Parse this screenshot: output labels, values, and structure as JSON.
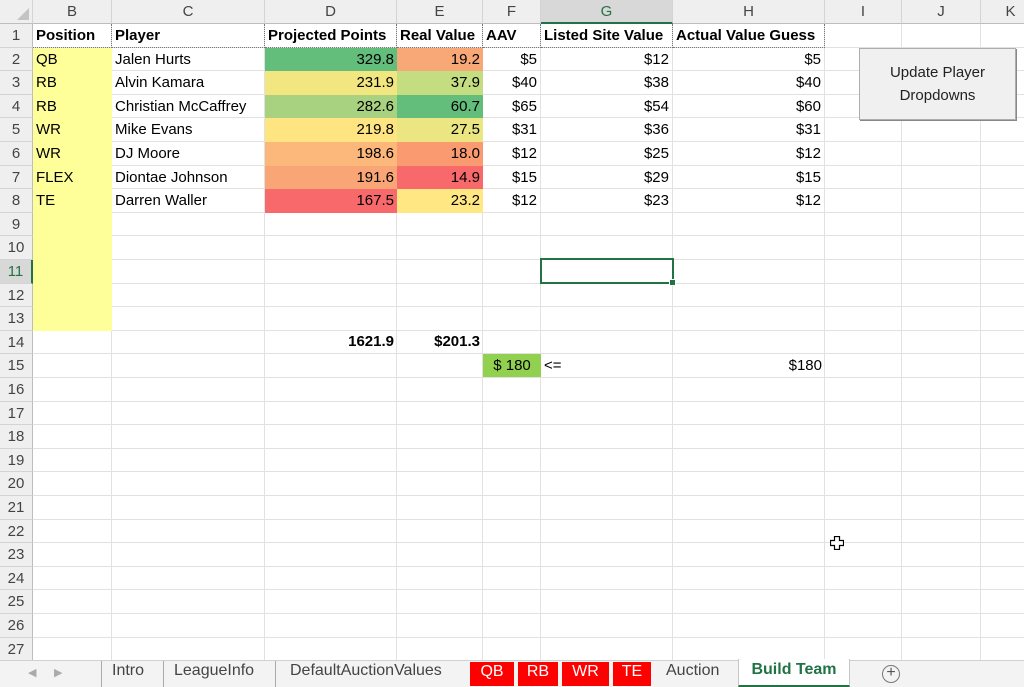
{
  "columns": [
    "B",
    "C",
    "D",
    "E",
    "F",
    "G",
    "H",
    "I",
    "J",
    "K"
  ],
  "selected_column": "G",
  "row_numbers": [
    "1",
    "2",
    "3",
    "4",
    "5",
    "6",
    "7",
    "8",
    "9",
    "10",
    "11",
    "12",
    "13",
    "14",
    "15",
    "16",
    "17",
    "18",
    "19",
    "20",
    "21",
    "22",
    "23",
    "24",
    "25",
    "26",
    "27"
  ],
  "selected_row": "11",
  "headers": {
    "position": "Position",
    "player": "Player",
    "projected_points": "Projected Points",
    "real_value": "Real Value",
    "aav": "AAV",
    "listed_site_value": "Listed Site Value",
    "actual_value_guess": "Actual Value Guess"
  },
  "rows": [
    {
      "position": "QB",
      "player": "Jalen Hurts",
      "projected_points": "329.8",
      "real_value": "19.2",
      "aav": "$5",
      "listed_site_value": "$12",
      "actual_value_guess": "$5",
      "pp_color": "#63be7b",
      "rv_color": "#f8a777"
    },
    {
      "position": "RB",
      "player": "Alvin Kamara",
      "projected_points": "231.9",
      "real_value": "37.9",
      "aav": "$40",
      "listed_site_value": "$38",
      "actual_value_guess": "$40",
      "pp_color": "#f1e67f",
      "rv_color": "#c4dd80"
    },
    {
      "position": "RB",
      "player": "Christian McCaffrey",
      "projected_points": "282.6",
      "real_value": "60.7",
      "aav": "$65",
      "listed_site_value": "$54",
      "actual_value_guess": "$60",
      "pp_color": "#a8d27f",
      "rv_color": "#63be7b"
    },
    {
      "position": "WR",
      "player": "Mike Evans",
      "projected_points": "219.8",
      "real_value": "27.5",
      "aav": "$31",
      "listed_site_value": "$36",
      "actual_value_guess": "$31",
      "pp_color": "#fee582",
      "rv_color": "#ebe582"
    },
    {
      "position": "WR",
      "player": "DJ Moore",
      "projected_points": "198.6",
      "real_value": "18.0",
      "aav": "$12",
      "listed_site_value": "$25",
      "actual_value_guess": "$12",
      "pp_color": "#fcb77a",
      "rv_color": "#f99a71"
    },
    {
      "position": "FLEX",
      "player": "Diontae Johnson",
      "projected_points": "191.6",
      "real_value": "14.9",
      "aav": "$15",
      "listed_site_value": "$29",
      "actual_value_guess": "$15",
      "pp_color": "#faa575",
      "rv_color": "#f8696b"
    },
    {
      "position": "TE",
      "player": "Darren Waller",
      "projected_points": "167.5",
      "real_value": "23.2",
      "aav": "$12",
      "listed_site_value": "$23",
      "actual_value_guess": "$12",
      "pp_color": "#f8696b",
      "rv_color": "#ffe783"
    }
  ],
  "totals": {
    "projected_points": "1621.9",
    "real_value": "$201.3"
  },
  "budget": {
    "aav_total": "$ 180",
    "comparator": "<=",
    "budget_value": "$180",
    "aav_total_color": "#92d050"
  },
  "position_fill_color": "#ffff99",
  "macro_button": {
    "line1": "Update Player",
    "line2": "Dropdowns"
  },
  "sheet_tabs": [
    {
      "label": "Intro",
      "style": "normal"
    },
    {
      "label": "LeagueInfo",
      "style": "normal"
    },
    {
      "label": "DefaultAuctionValues",
      "style": "normal"
    },
    {
      "label": "QB",
      "style": "red"
    },
    {
      "label": "RB",
      "style": "red"
    },
    {
      "label": "WR",
      "style": "red"
    },
    {
      "label": "TE",
      "style": "red"
    },
    {
      "label": "Auction",
      "style": "normal"
    },
    {
      "label": "Build Team",
      "style": "active"
    }
  ],
  "icons": {
    "nav_prev": "◀",
    "nav_next": "▶",
    "add_sheet": "+"
  }
}
